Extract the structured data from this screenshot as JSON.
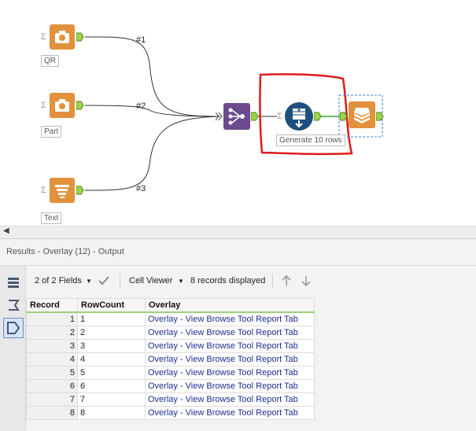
{
  "canvas": {
    "inputs": [
      {
        "label": "QR",
        "conn_label": "#1",
        "icon": "camera-icon"
      },
      {
        "label": "Part",
        "conn_label": "#2",
        "icon": "camera-icon"
      },
      {
        "label": "Text",
        "conn_label": "#3",
        "icon": "text-lines-icon"
      }
    ],
    "anchor_sigma": "Σ",
    "generate_label": "Generate 10 rows",
    "colors": {
      "orange": "#e2913c",
      "purple": "#6b4a8f",
      "blue": "#1f4f7e",
      "highlight": "#e01b1b",
      "selection": "#3b7fd0"
    }
  },
  "results": {
    "title": "Results - Overlay (12) - Output",
    "toolbar": {
      "fields": "2 of 2 Fields",
      "viewer": "Cell Viewer",
      "records": "8 records displayed"
    },
    "columns": [
      "Record",
      "RowCount",
      "Overlay"
    ],
    "rows": [
      {
        "record": "1",
        "rowcount": "1",
        "overlay": "Overlay - View Browse Tool Report Tab"
      },
      {
        "record": "2",
        "rowcount": "2",
        "overlay": "Overlay - View Browse Tool Report Tab"
      },
      {
        "record": "3",
        "rowcount": "3",
        "overlay": "Overlay - View Browse Tool Report Tab"
      },
      {
        "record": "4",
        "rowcount": "4",
        "overlay": "Overlay - View Browse Tool Report Tab"
      },
      {
        "record": "5",
        "rowcount": "5",
        "overlay": "Overlay - View Browse Tool Report Tab"
      },
      {
        "record": "6",
        "rowcount": "6",
        "overlay": "Overlay - View Browse Tool Report Tab"
      },
      {
        "record": "7",
        "rowcount": "7",
        "overlay": "Overlay - View Browse Tool Report Tab"
      },
      {
        "record": "8",
        "rowcount": "8",
        "overlay": "Overlay - View Browse Tool Report Tab"
      }
    ]
  }
}
